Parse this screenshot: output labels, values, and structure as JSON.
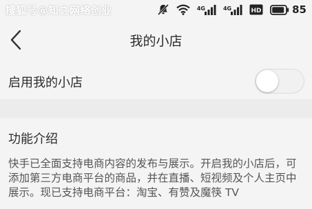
{
  "status_bar": {
    "watermark_text": "搜狐号@知之网络创业",
    "network_labels": [
      "4G",
      "4G"
    ],
    "battery_label": "HD",
    "battery_level": "85"
  },
  "nav": {
    "title": "我的小店"
  },
  "settings": {
    "enable_label": "启用我的小店",
    "enabled": false
  },
  "intro": {
    "title": "功能介绍",
    "body": "快手已全面支持电商内容的发布与展示。开启我的小店后，可添加第三方电商平台的商品，并在直播、短视频及个人主页中展示。现已支持电商平台：淘宝、有赞及魔筷 TV"
  }
}
